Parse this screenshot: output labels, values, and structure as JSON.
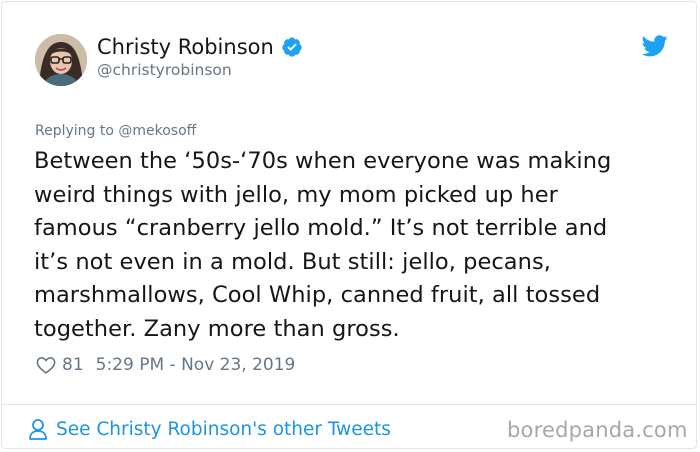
{
  "author": {
    "name": "Christy Robinson",
    "handle": "@christyrobinson",
    "verified": true
  },
  "replying_to": "Replying to @mekosoff",
  "tweet": {
    "lines": [
      "Between the ‘50s-‘70s when everyone was making",
      "weird things with jello, my mom picked up her",
      "famous “cranberry jello mold.” It’s not terrible and",
      "it’s not even in a mold. But still: jello, pecans,",
      "marshmallows, Cool Whip, canned fruit, all tossed",
      "together. Zany more than gross."
    ]
  },
  "meta": {
    "likes": "81",
    "timestamp": "5:29 PM - Nov 23, 2019"
  },
  "footer": {
    "see_more": "See Christy Robinson's other Tweets",
    "watermark": "boredpanda.com"
  },
  "icons": {
    "verified": "verified-badge-icon",
    "bird": "twitter-bird-icon",
    "like": "heart-icon",
    "profile": "person-icon"
  },
  "colors": {
    "accent": "#1da1f2",
    "link": "#1b95e0",
    "text": "#14171a",
    "muted": "#657786",
    "border": "#e1e8ed"
  }
}
